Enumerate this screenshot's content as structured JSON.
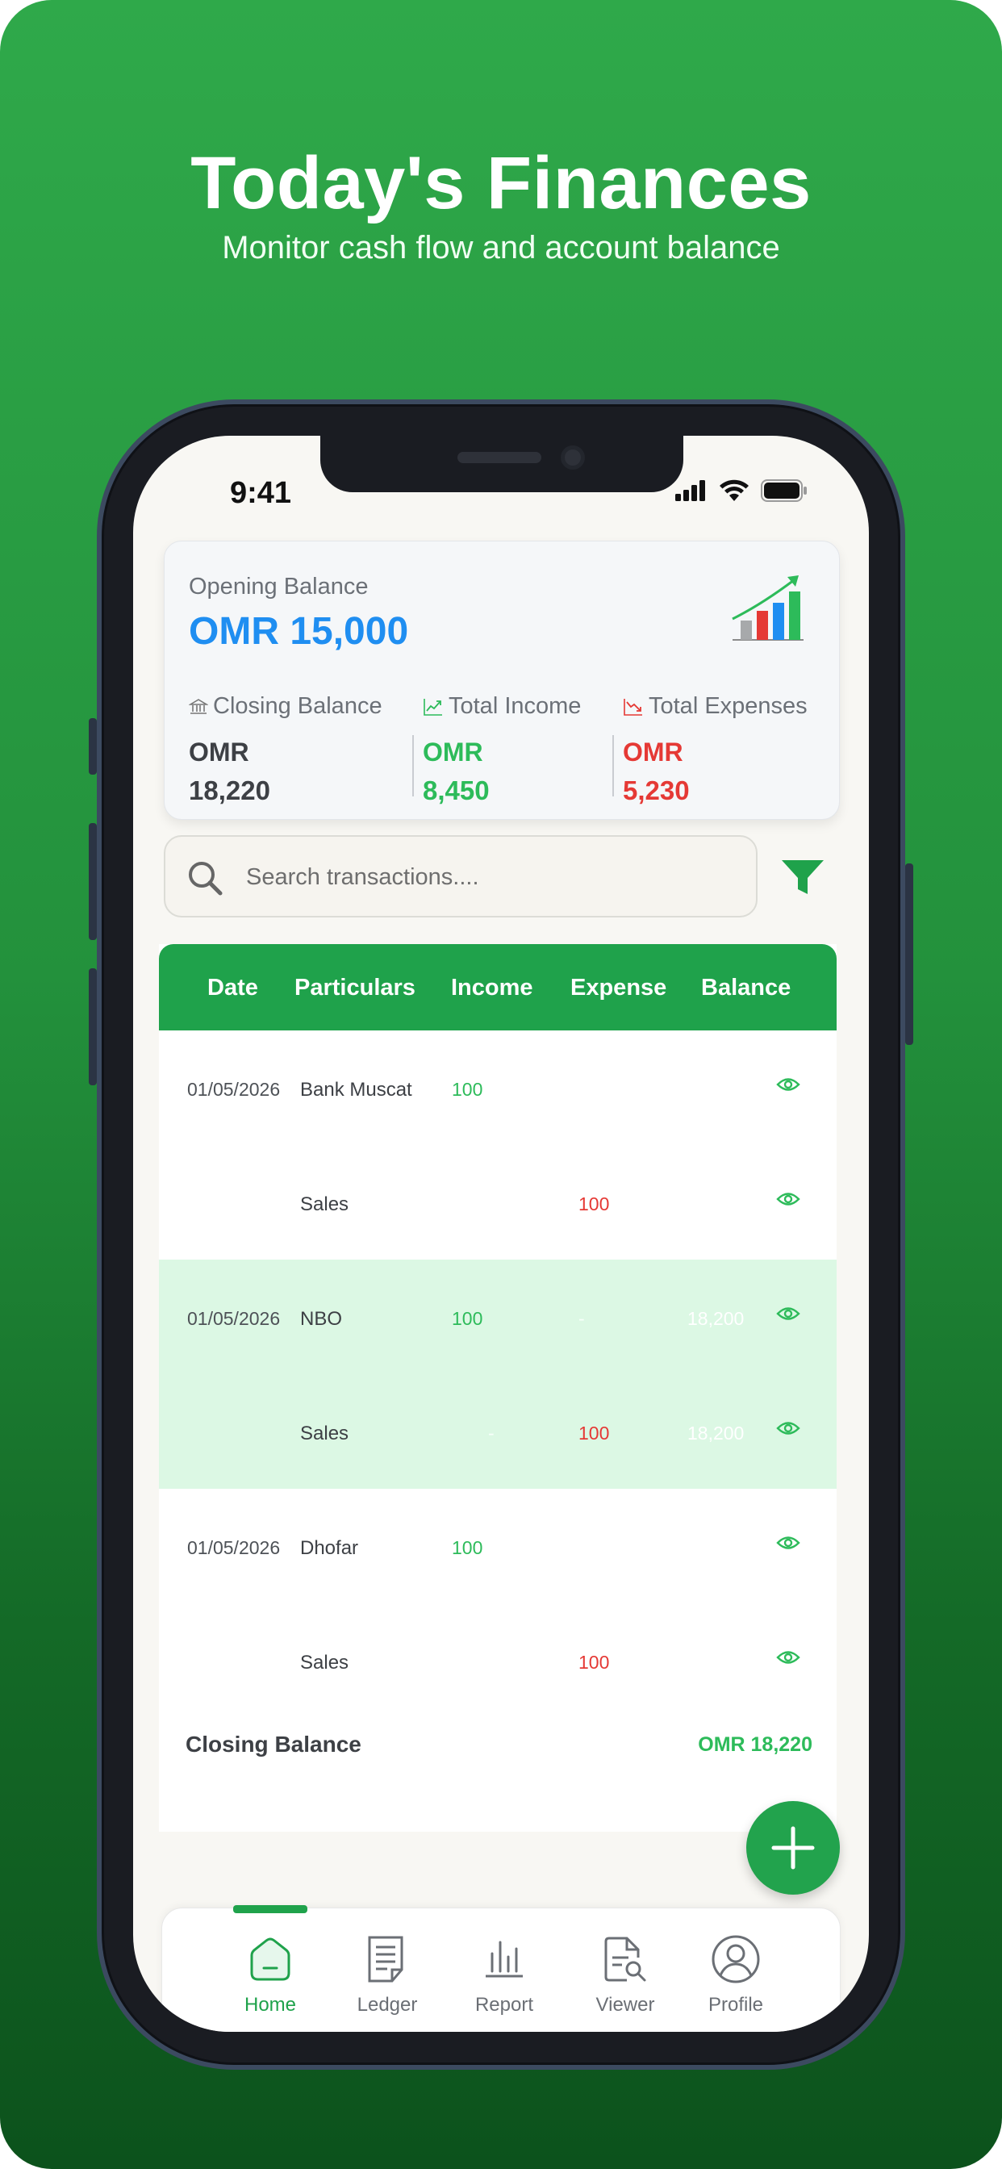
{
  "hero": {
    "title": "Today's Finances",
    "subtitle": "Monitor cash flow and account balance"
  },
  "status_bar": {
    "time": "9:41"
  },
  "summary": {
    "opening_label": "Opening Balance",
    "opening_value": "OMR 15,000",
    "closing": {
      "label": "Closing Balance",
      "currency": "OMR",
      "amount": "18,220",
      "icon": "bank-icon"
    },
    "income": {
      "label": "Total Income",
      "currency": "OMR",
      "amount": "8,450",
      "icon": "trend-up-icon"
    },
    "expenses": {
      "label": "Total Expenses",
      "currency": "OMR",
      "amount": "5,230",
      "icon": "trend-down-icon"
    }
  },
  "search": {
    "placeholder": "Search transactions...."
  },
  "table": {
    "headers": [
      "Date",
      "Particulars",
      "Income",
      "Expense",
      "Balance"
    ],
    "rows": [
      {
        "date": "01/05/2026",
        "particulars": "Bank Muscat",
        "income": "100",
        "expense": "",
        "balance": ""
      },
      {
        "date": "",
        "particulars": "Sales",
        "income": "",
        "expense": "100",
        "balance": ""
      },
      {
        "date": "01/05/2026",
        "particulars": "NBO",
        "income": "100",
        "expense": "-",
        "balance": "18,200"
      },
      {
        "date": "",
        "particulars": "Sales",
        "income": "-",
        "expense": "100",
        "balance": "18,200"
      },
      {
        "date": "01/05/2026",
        "particulars": "Dhofar",
        "income": "100",
        "expense": "",
        "balance": ""
      },
      {
        "date": "",
        "particulars": "Sales",
        "income": "",
        "expense": "100",
        "balance": ""
      }
    ],
    "closing_label": "Closing Balance",
    "closing_value": "OMR 18,220"
  },
  "nav": {
    "items": [
      {
        "label": "Home",
        "icon": "home-icon"
      },
      {
        "label": "Ledger",
        "icon": "ledger-icon"
      },
      {
        "label": "Report",
        "icon": "report-icon"
      },
      {
        "label": "Viewer",
        "icon": "viewer-icon"
      },
      {
        "label": "Profile",
        "icon": "profile-icon"
      }
    ]
  },
  "colors": {
    "brand_green": "#1fa24b",
    "income_green": "#2dbb5a",
    "expense_red": "#e53935",
    "opening_blue": "#1f8ef1"
  }
}
